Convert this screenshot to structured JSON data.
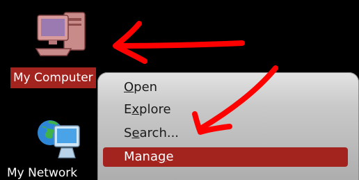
{
  "desktop": {
    "background_color": "#000000",
    "icons": [
      {
        "label": "My Computer",
        "icon": "my-computer-icon",
        "selected": true
      },
      {
        "label": "My Network",
        "icon": "my-network-places-icon",
        "selected": false
      }
    ]
  },
  "context_menu": {
    "items": [
      {
        "label": "Open",
        "access_key": "O"
      },
      {
        "label": "Explore",
        "access_key": "x"
      },
      {
        "label": "Search...",
        "access_key": "e"
      },
      {
        "label": "Manage",
        "access_key": "g",
        "highlighted": true
      }
    ]
  },
  "colors": {
    "selection": "#a3231e",
    "annotation": "#ff0000",
    "menu_text": "#1a1a1a"
  }
}
